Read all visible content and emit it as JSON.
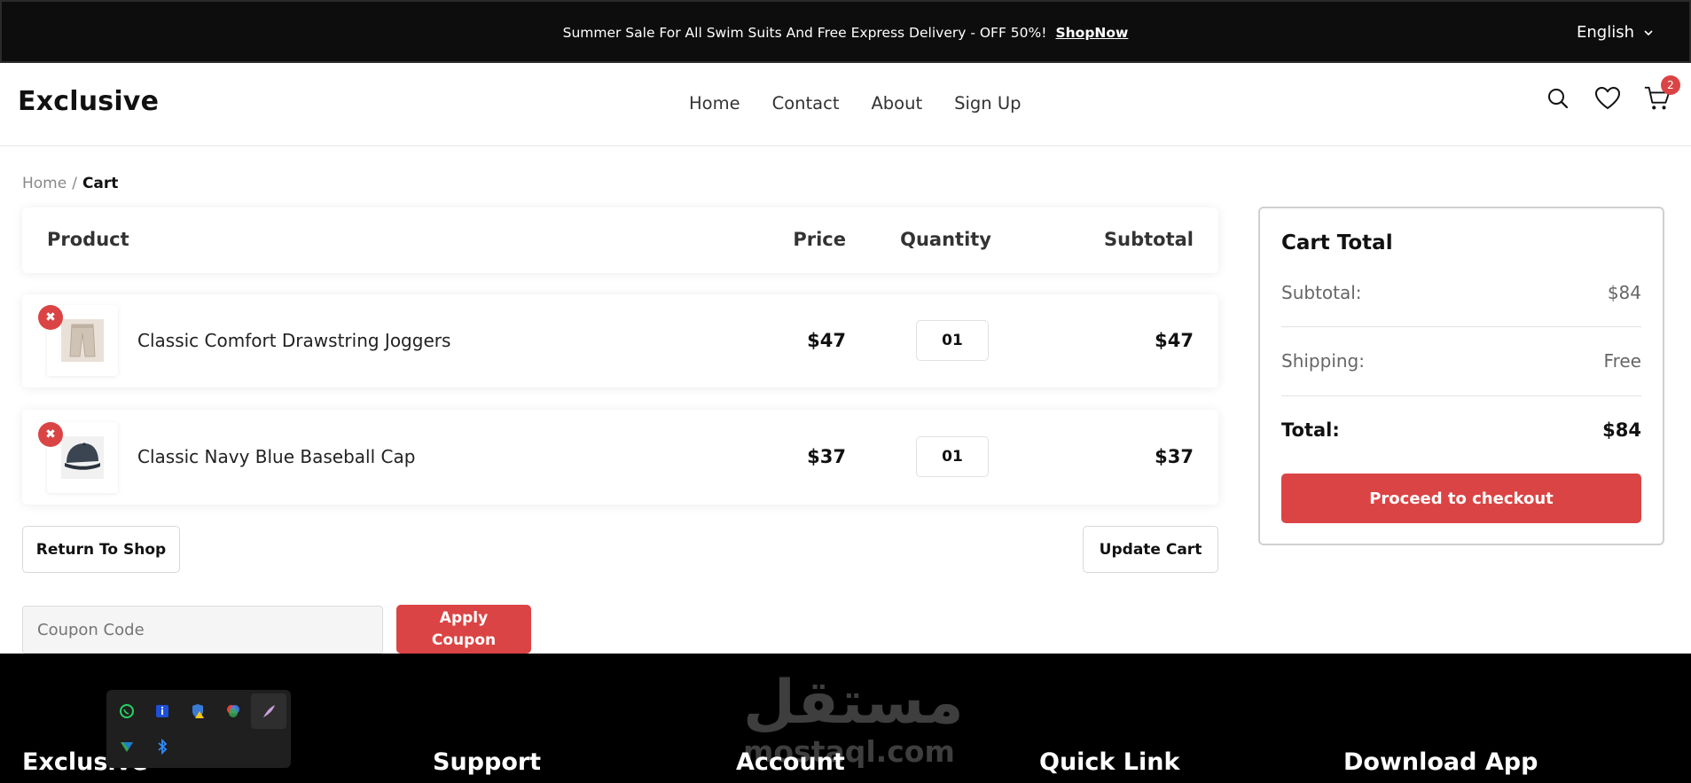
{
  "banner": {
    "text": "Summer Sale For All Swim Suits And Free Express Delivery - OFF 50%!",
    "link": "ShopNow",
    "language": "English"
  },
  "header": {
    "logo": "Exclusive",
    "nav": [
      "Home",
      "Contact",
      "About",
      "Sign Up"
    ],
    "cart_count": "2"
  },
  "breadcrumb": {
    "home": "Home",
    "separator": "/",
    "current": "Cart"
  },
  "table": {
    "headers": {
      "product": "Product",
      "price": "Price",
      "quantity": "Quantity",
      "subtotal": "Subtotal"
    },
    "rows": [
      {
        "name": "Classic Comfort Drawstring Joggers",
        "price": "$47",
        "quantity": "01",
        "subtotal": "$47",
        "image": "joggers-image"
      },
      {
        "name": "Classic Navy Blue Baseball Cap",
        "price": "$37",
        "quantity": "01",
        "subtotal": "$37",
        "image": "cap-image"
      }
    ]
  },
  "actions": {
    "return": "Return To Shop",
    "update": "Update Cart",
    "coupon_placeholder": "Coupon Code",
    "apply_line1": "Apply",
    "apply_line2": "Coupon"
  },
  "cart_total": {
    "title": "Cart Total",
    "subtotal_label": "Subtotal:",
    "subtotal_value": "$84",
    "shipping_label": "Shipping:",
    "shipping_value": "Free",
    "total_label": "Total:",
    "total_value": "$84",
    "checkout": "Proceed to checkout"
  },
  "footer": {
    "columns": [
      "Exclusive",
      "Support",
      "Account",
      "Quick Link",
      "Download App"
    ],
    "watermark_ar": "مستقل",
    "watermark_en": "mostaql.com"
  },
  "tray_icons": [
    "whatsapp-icon",
    "info-icon",
    "shield-warning-icon",
    "colorful-app-icon",
    "feather-icon",
    "network-icon",
    "bluetooth-icon"
  ],
  "colors": {
    "accent": "#db4444",
    "dark": "#000000"
  }
}
